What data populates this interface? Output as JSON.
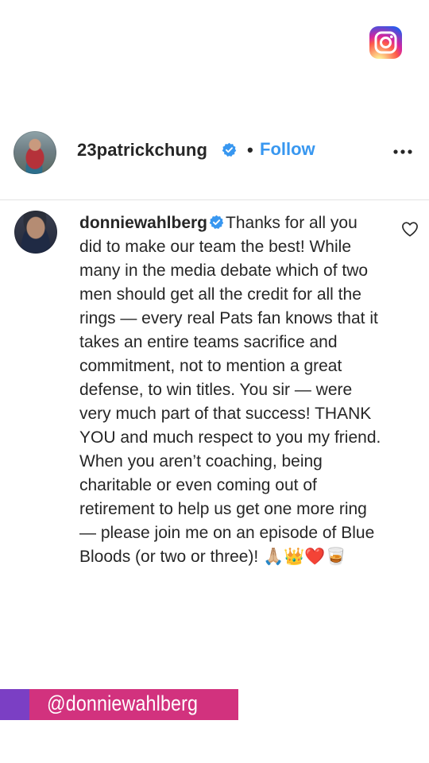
{
  "app": {
    "logo_icon": "instagram-icon"
  },
  "post": {
    "author": {
      "username": "23patrickchung",
      "verified": true,
      "verified_icon": "verified-badge-icon"
    },
    "separator": "•",
    "follow_label": "Follow",
    "more_icon": "more-options-icon"
  },
  "comment": {
    "username": "donniewahlberg",
    "verified": true,
    "text": "Thanks for all you did to make our team the best! While many in the media debate which of two men should get all the credit for all the rings — every real Pats fan knows that it takes an entire teams sacrifice and commitment, not to mention a great defense, to win titles. You sir — were very much part of that success! THANK YOU and much respect to you my friend. When you aren’t coaching, being charitable or even coming out of retirement to help us get one more ring — please join me on an episode of Blue Bloods (or two or three)! 🙏🏼👑❤️🥃",
    "like_icon": "heart-outline-icon"
  },
  "overlay": {
    "handle": "@donniewahlberg"
  },
  "colors": {
    "link": "#3897f0",
    "verified": "#3897f0",
    "banner_pink": "#d2327e",
    "banner_purple": "#7b3fc4"
  }
}
